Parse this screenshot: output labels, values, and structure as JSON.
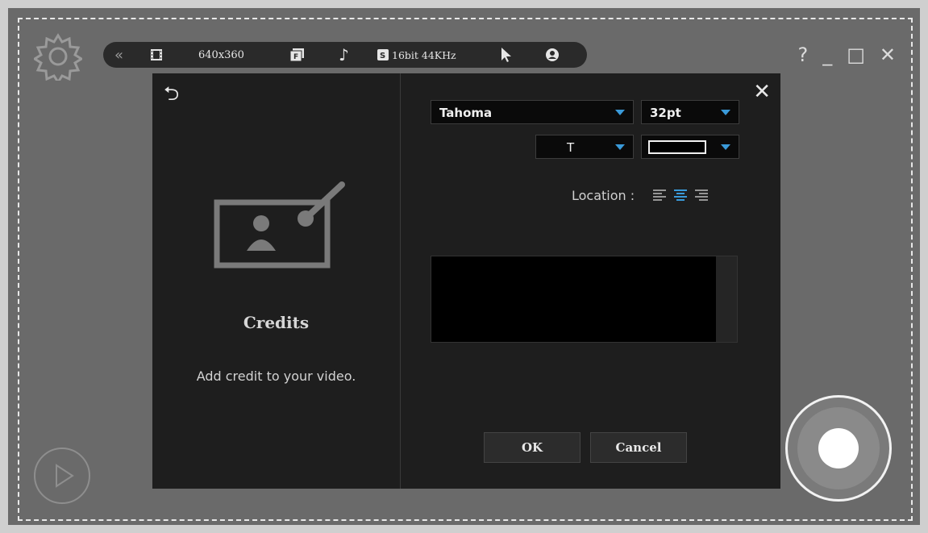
{
  "toolbar": {
    "resolution": "640x360",
    "audio_badge": "S",
    "audio": "16bit 44KHz"
  },
  "window": {
    "help": "?",
    "minimize": "_",
    "maximize": "□",
    "close": "✕"
  },
  "dialog": {
    "back": "⮌",
    "close": "✕",
    "title": "Credits",
    "description": "Add credit to your video.",
    "font_value": "Tahoma",
    "size_value": "32pt",
    "style_value": "T",
    "location_label": "Location :",
    "ok_label": "OK",
    "cancel_label": "Cancel",
    "accent_color": "#3a9ad9"
  }
}
